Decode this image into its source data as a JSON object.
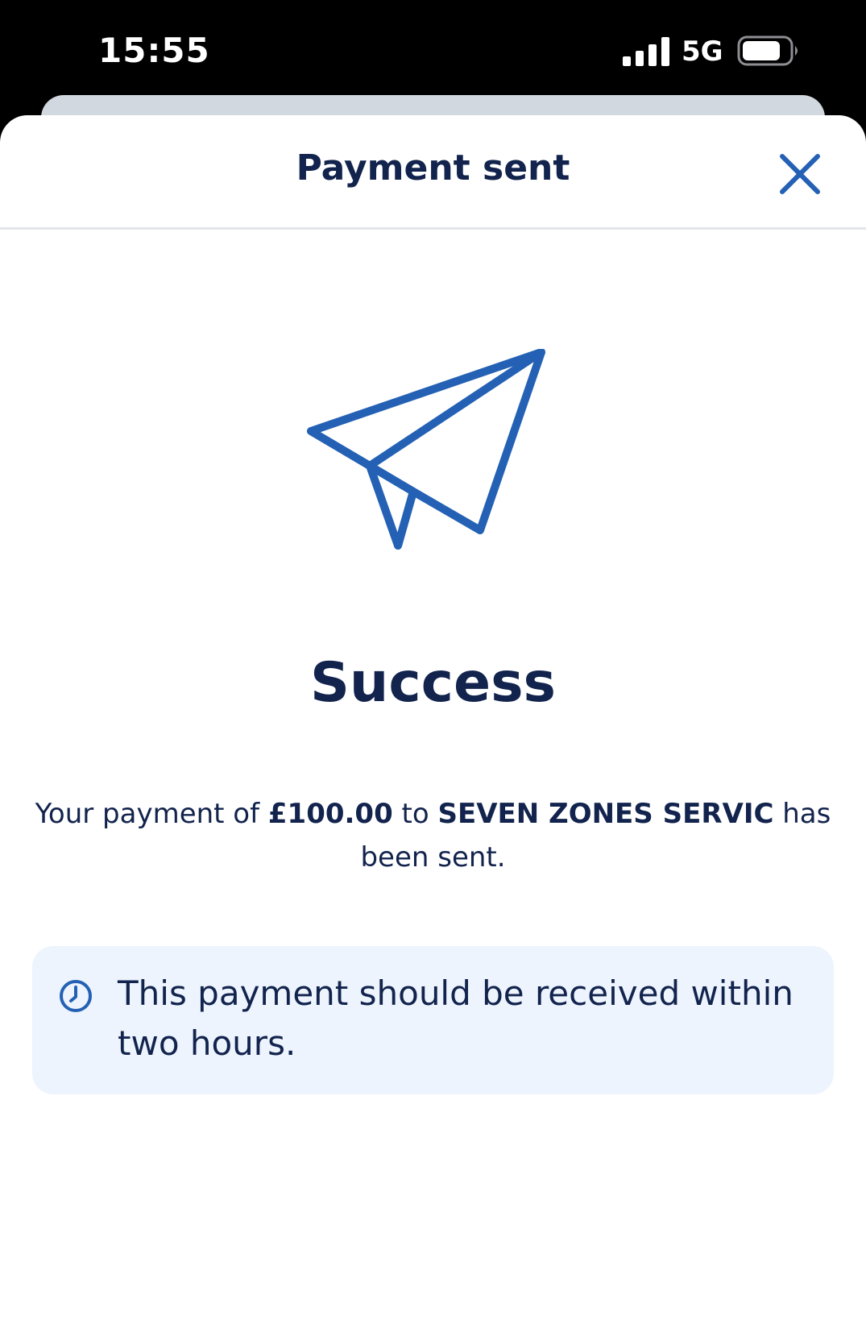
{
  "status_bar": {
    "time": "15:55",
    "network": "5G",
    "signal_icon": "cellular-signal-icon",
    "battery_icon": "battery-icon"
  },
  "header": {
    "title": "Payment sent",
    "close_icon": "close-icon"
  },
  "main": {
    "illustration_icon": "paper-plane-icon",
    "heading": "Success",
    "message": {
      "prefix": "Your payment of ",
      "amount": "£100.00",
      "middle": " to ",
      "payee": "SEVEN ZONES SERVIC",
      "suffix": " has been sent."
    },
    "info": {
      "icon": "clock-icon",
      "text": "This payment should be received within two hours."
    }
  },
  "colors": {
    "accent": "#2461b4",
    "text": "#12234d",
    "banner_background": "#edf4fd",
    "divider": "#e3e5e9"
  }
}
